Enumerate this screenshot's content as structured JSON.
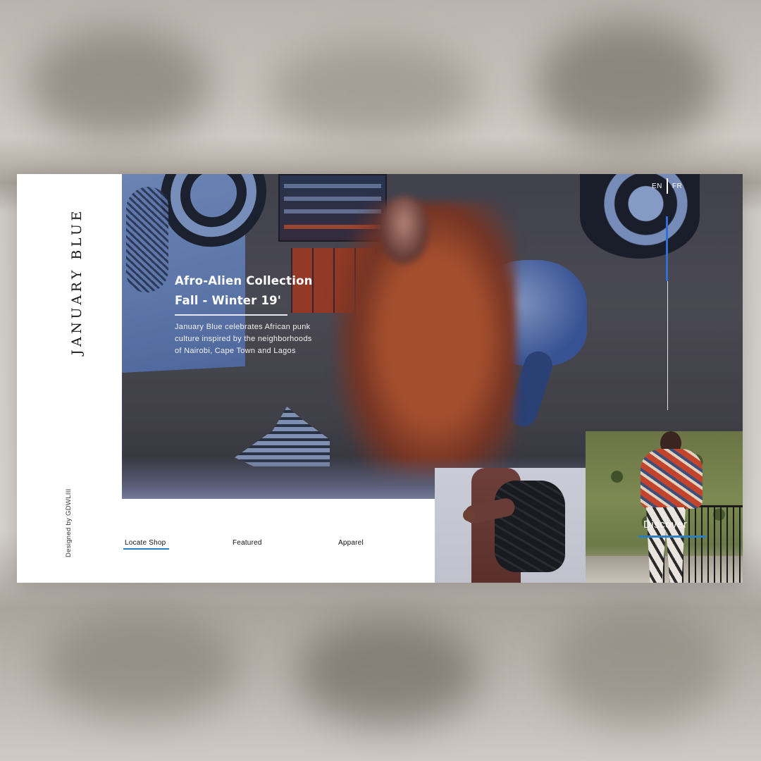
{
  "brand": {
    "name": "JANUARY BLUE",
    "credit": "Designed by GDWLIII"
  },
  "hero": {
    "title_line1": "Afro-Alien Collection",
    "title_line2": "Fall - Winter 19'",
    "description": "January Blue celebrates African punk culture inspired by the neighborhoods of Nairobi, Cape Town and Lagos"
  },
  "language": {
    "options": [
      "EN",
      "FR"
    ],
    "selected": "EN"
  },
  "nav": {
    "items": [
      {
        "label": "Locate Shop",
        "active": true
      },
      {
        "label": "Featured",
        "active": false
      },
      {
        "label": "Apparel",
        "active": false
      }
    ]
  },
  "discover": {
    "label": "Discover"
  },
  "colors": {
    "accent": "#2a7fc0",
    "scroll_thumb": "#2f6fd6",
    "background": "#ffffff",
    "text_dark": "#111111"
  }
}
